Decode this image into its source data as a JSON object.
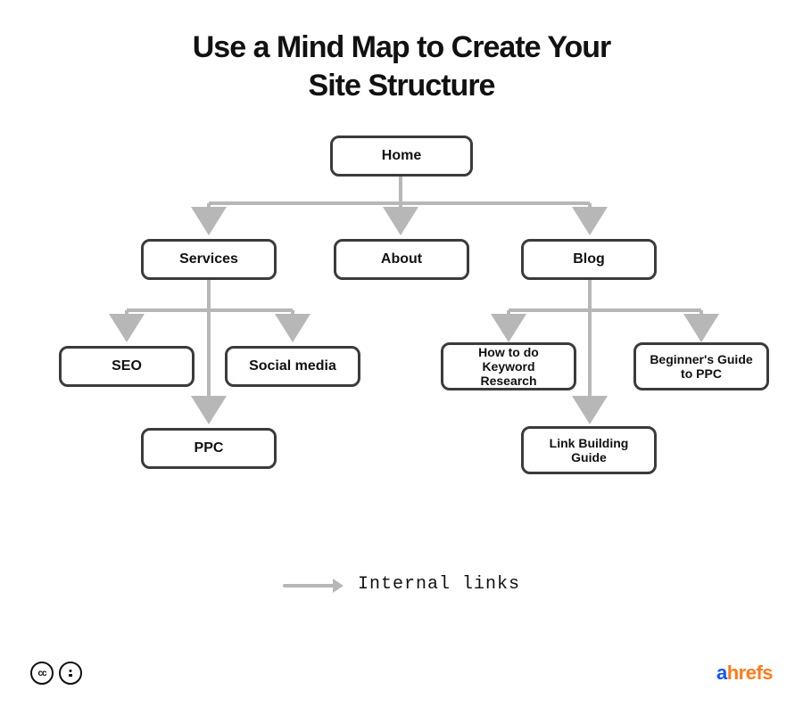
{
  "title_line1": "Use a Mind Map to Create Your",
  "title_line2": "Site Structure",
  "nodes": {
    "home": "Home",
    "services": "Services",
    "about": "About",
    "blog": "Blog",
    "seo": "SEO",
    "social": "Social media",
    "ppc": "PPC",
    "kw": "How to do Keyword Research",
    "begppc": "Beginner's Guide to PPC",
    "linkbuild": "Link Building Guide"
  },
  "legend": "Internal links",
  "brand_a": "a",
  "brand_rest": "hrefs",
  "cc_label": "cc"
}
